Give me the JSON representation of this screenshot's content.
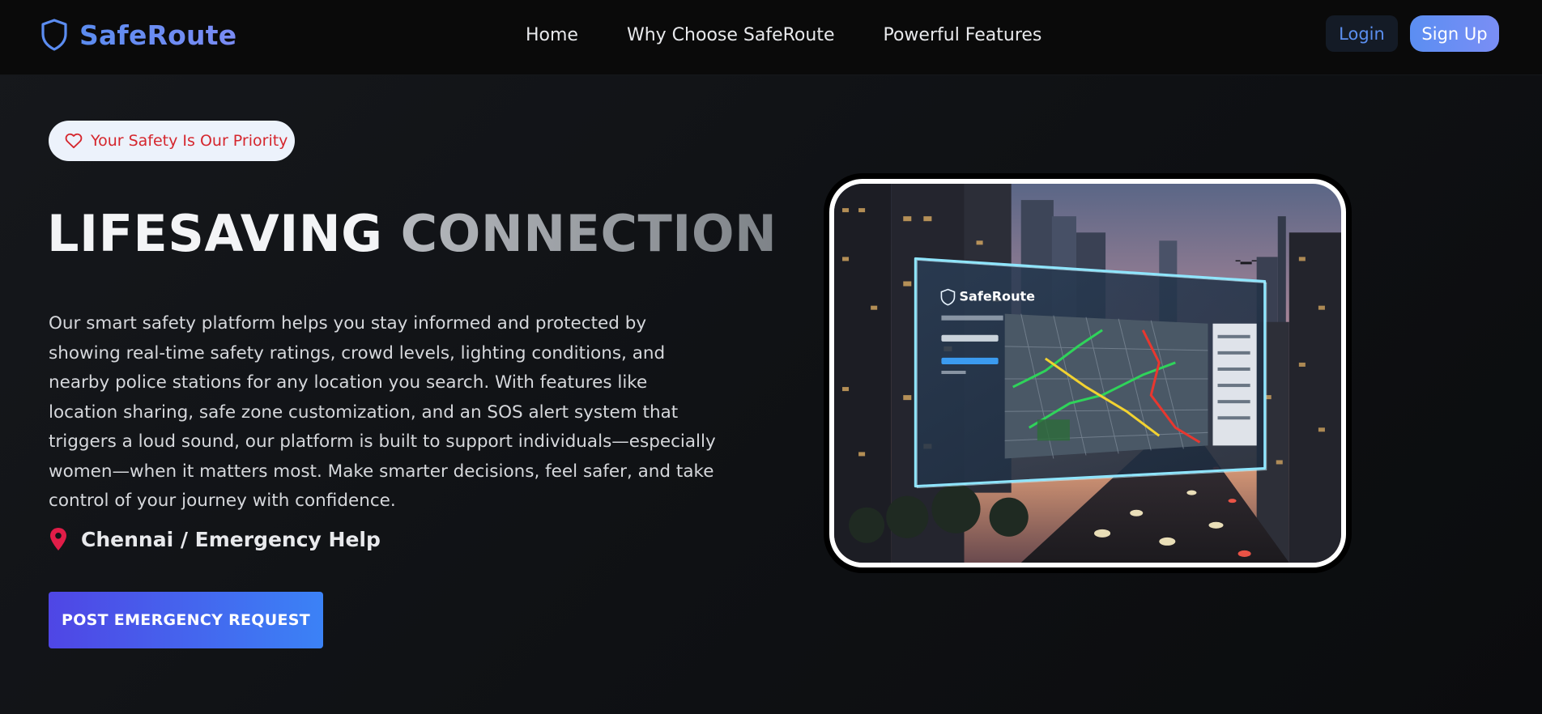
{
  "nav": {
    "brand": "SafeRoute",
    "links": [
      "Home",
      "Why Choose SafeRoute",
      "Powerful Features"
    ],
    "login": "Login",
    "signup": "Sign Up"
  },
  "hero": {
    "badge": "Your Safety Is Our Priority",
    "title_part1": "LIFESAVING",
    "title_part2": "CONNECTION",
    "description": "Our smart safety platform helps you stay informed and protected by showing real-time safety ratings, crowd levels, lighting conditions, and nearby police stations for any location you search. With features like location sharing, safe zone customization, and an SOS alert system that triggers a loud sound, our platform is built to support individuals—especially women—when it matters most. Make smarter decisions, feel safer, and take control of your journey with confidence.",
    "location": "Chennai / Emergency Help",
    "cta": "POST EMERGENCY REQUEST"
  },
  "image": {
    "brand": "SafeRoute"
  },
  "colors": {
    "accent_blue": "#5b8ef2",
    "badge_red": "#d5262d",
    "cta_start": "#4f46e5",
    "cta_end": "#3b82f6"
  },
  "icons": {
    "brand": "shield-icon",
    "badge": "heart-icon",
    "location": "map-pin-icon"
  }
}
